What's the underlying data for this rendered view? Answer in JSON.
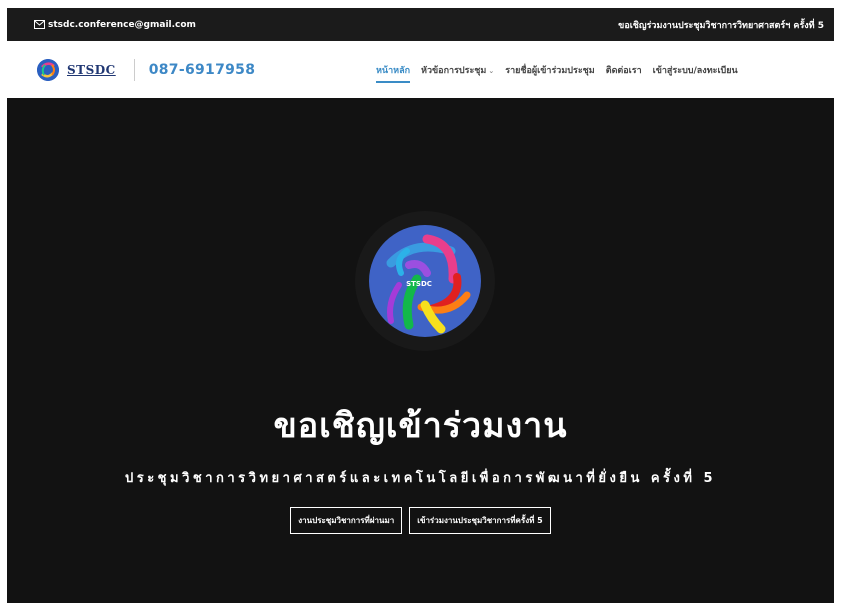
{
  "topbar": {
    "email": "stsdc.conference@gmail.com",
    "announcement": "ขอเชิญร่วมงานประชุมวิชาการวิทยาศาสตร์ฯ ครั้งที่ 5"
  },
  "navbar": {
    "brand_name": "STSDC",
    "phone": "087-6917958",
    "menu": [
      {
        "label": "หน้าหลัก",
        "active": true
      },
      {
        "label": "หัวข้อการประชุม",
        "dropdown": true
      },
      {
        "label": "รายชื่อผู้เข้าร่วมประชุม"
      },
      {
        "label": "ติดต่อเรา"
      },
      {
        "label": "เข้าสู่ระบบ/ลงทะเบียน"
      }
    ]
  },
  "hero": {
    "logo_text": "STSDC",
    "title": "ขอเชิญเข้าร่วมงาน",
    "subtitle": "ประชุมวิชาการวิทยาศาสตร์และเทคโนโลยีเพื่อการพัฒนาที่ยั่งยืน ครั้งที่ 5",
    "buttons": [
      {
        "label": "งานประชุมวิชาการที่ผ่านมา"
      },
      {
        "label": "เข้าร่วมงานประชุมวิชาการที่ครั้งที่ 5"
      }
    ]
  },
  "colors": {
    "topbar_bg": "#1b1b1b",
    "hero_bg": "#121212",
    "accent": "#3a8cc6",
    "brand": "#1f3672"
  },
  "icons": {
    "email": "envelope-icon",
    "dropdown": "chevron-down-icon"
  }
}
